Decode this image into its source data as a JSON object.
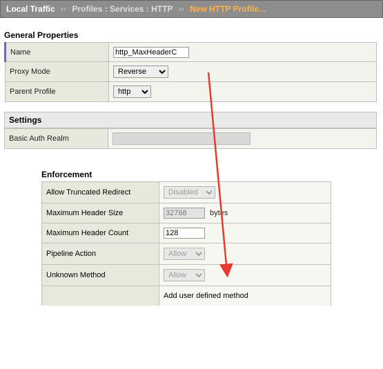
{
  "breadcrumb": {
    "root": "Local Traffic",
    "crumb1": "Profiles : Services : HTTP",
    "current": "New HTTP Profile..."
  },
  "general": {
    "title": "General Properties",
    "name_label": "Name",
    "name_value": "http_MaxHeaderC",
    "proxy_label": "Proxy Mode",
    "proxy_value": "Reverse",
    "parent_label": "Parent Profile",
    "parent_value": "http"
  },
  "settings": {
    "title": "Settings",
    "bar_label": "Basic Auth Realm"
  },
  "enforcement": {
    "title": "Enforcement",
    "rows": {
      "trunc_label": "Allow Truncated Redirect",
      "trunc_value": "Disabled",
      "mhs_label": "Maximum Header Size",
      "mhs_value": "32768",
      "mhs_unit": "bytes",
      "mhc_label": "Maximum Header Count",
      "mhc_value": "128",
      "pipe_label": "Pipeline Action",
      "pipe_value": "Allow",
      "unk_label": "Unknown Method",
      "unk_value": "Allow",
      "add_label": "Add user defined method"
    }
  },
  "annotation": {
    "color": "#e73a2f"
  }
}
